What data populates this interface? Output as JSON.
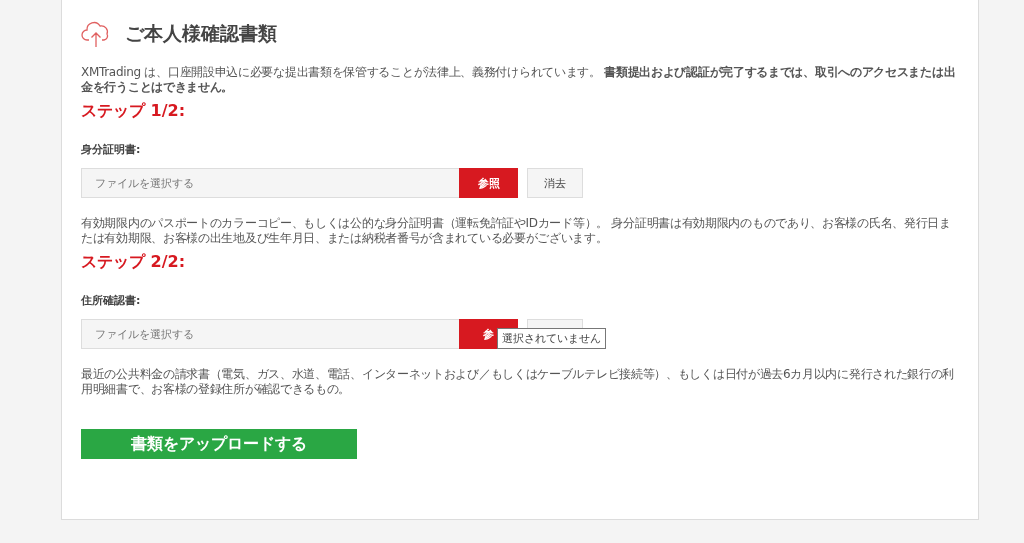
{
  "title": "ご本人様確認書類",
  "intro": "XMTrading は、口座開設申込に必要な提出書類を保管することが法律上、義務付けられています。 **書類提出および認証が完了するまでは、取引へのアクセスまたは出金を行うことはできません。**",
  "steps": [
    {
      "heading": "ステップ 1/2:",
      "label": "身分証明書:",
      "placeholder": "ファイルを選択する",
      "browse": "参照",
      "clear": "消去",
      "description": "有効期限内のパスポートのカラーコピー、もしくは公的な身分証明書（運転免許証やIDカード等）。 身分証明書は有効期限内のものであり、お客様の氏名、発行日または有効期限、お客様の出生地及び生年月日、または納税者番号が含まれている必要がございます。"
    },
    {
      "heading": "ステップ 2/2:",
      "label": "住所確認書:",
      "placeholder": "ファイルを選択する",
      "browse": "参",
      "tooltip": "選択されていません",
      "description": "最近の公共料金の請求書（電気、ガス、水道、電話、インターネットおよび／もしくはケーブルテレビ接続等）、もしくは日付が過去6カ月以内に発行された銀行の利用明細書で、お客様の登録住所が確認できるもの。"
    }
  ],
  "submit": "書類をアップロードする"
}
